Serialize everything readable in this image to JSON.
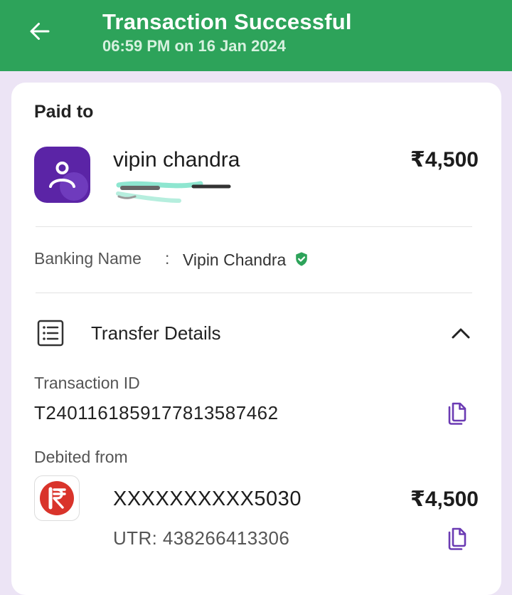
{
  "header": {
    "title": "Transaction Successful",
    "subtitle": "06:59 PM on 16 Jan 2024",
    "icon": "arrow-left-icon"
  },
  "payee": {
    "section_label": "Paid to",
    "name": "vipin chandra",
    "amount": "₹4,500",
    "avatar_icon": "person-icon"
  },
  "banking": {
    "label": "Banking Name",
    "separator": ":",
    "value": "Vipin Chandra",
    "badge_icon": "verified-check-icon"
  },
  "transfer_details": {
    "label": "Transfer Details",
    "icon": "receipt-list-icon",
    "toggle_icon": "chevron-up-icon",
    "transaction_id_label": "Transaction ID",
    "transaction_id": "T2401161859177813587462",
    "debited_from_label": "Debited from",
    "account": "XXXXXXXXXX5030",
    "amount": "₹4,500",
    "utr": "UTR: 438266413306",
    "copy_icon": "copy-icon"
  },
  "colors": {
    "header_green": "#2da35a",
    "avatar_purple": "#5b24a6",
    "copy_purple": "#6b3bb3",
    "verified_green": "#2da35a",
    "bank_red": "#d9342b",
    "page_bg": "#ece4f5"
  }
}
